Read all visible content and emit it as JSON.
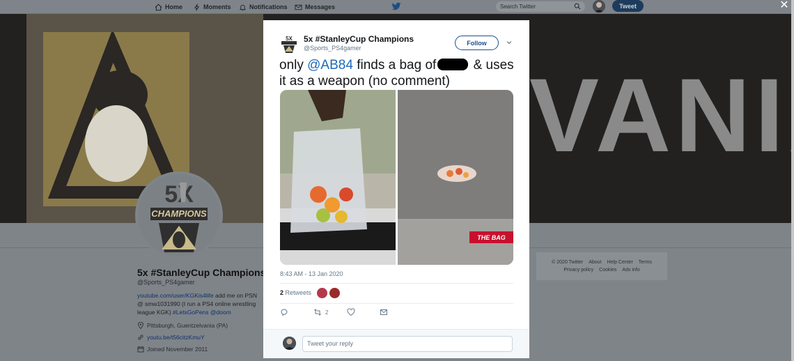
{
  "nav": {
    "home": "Home",
    "moments": "Moments",
    "notifications": "Notifications",
    "messages": "Messages",
    "search_placeholder": "Search Twitter",
    "tweet_button": "Tweet"
  },
  "banner": {
    "text": "VANIA"
  },
  "profile": {
    "name": "5x #StanleyCup Champions",
    "handle": "@Sports_PS4gamer",
    "bio_link": "youtube.com/user/KGKis4life",
    "bio_text": " add me on PSN @ smw1031990 (I run a PS4 online wrestling league KGK) ",
    "bio_hashtag": "#LetsGoPens",
    "bio_mention": "@doom",
    "location": "Pittsburgh, Guentzelvania (PA)",
    "website": "youtu.be/t56citzKmuY",
    "joined": "Joined November 2011"
  },
  "footer": {
    "copyright": "© 2020 Twitter",
    "about": "About",
    "help": "Help Center",
    "terms": "Terms",
    "privacy": "Privacy policy",
    "cookies": "Cookies",
    "ads": "Ads info"
  },
  "tweet": {
    "author_name": "5x #StanleyCup Champions",
    "author_handle": "@Sports_PS4gamer",
    "follow_label": "Follow",
    "text_before": "only ",
    "mention": "@AB84",
    "text_middle": " finds a bag of",
    "text_after": " & uses it as a weapon (no comment)",
    "media_label": "THE BAG",
    "timestamp": "8:43 AM - 13 Jan 2020",
    "retweet_count": "2",
    "retweet_label": "Retweets",
    "action_retweet_count": "2",
    "reply_placeholder": "Tweet your reply"
  },
  "colors": {
    "accent": "#1b6ab8",
    "tweet_button": "#1d3b5c",
    "bag_label": "#c8102e"
  }
}
